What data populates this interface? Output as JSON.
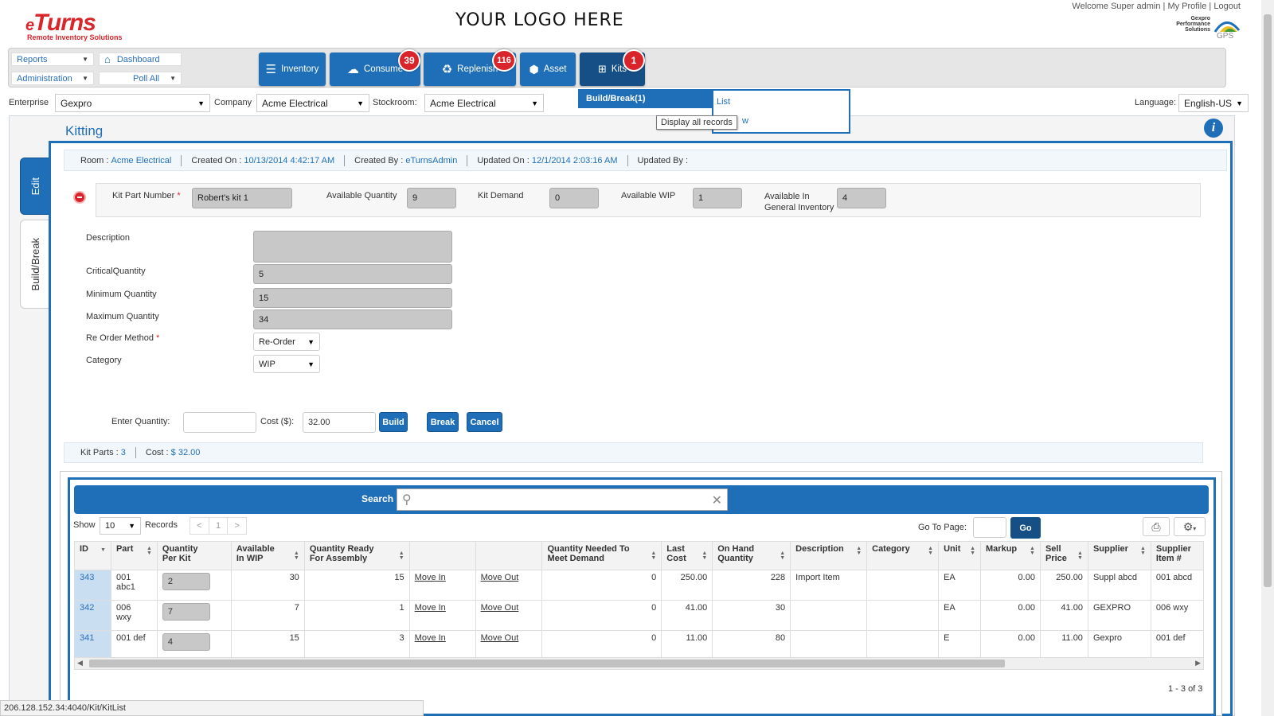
{
  "header": {
    "logo_e": "e",
    "logo_word": "Turns",
    "logo_sub": "Remote Inventory Solutions",
    "center_logo": "YOUR LOGO HERE",
    "welcome": "Welcome Super admin",
    "my_profile": "My Profile",
    "logout": "Logout",
    "gps_line1": "Gexpro",
    "gps_line2": "Performance",
    "gps_line3": "Solutions",
    "gps_abbr": "GPS"
  },
  "toolbar": {
    "reports": "Reports",
    "dashboard": "Dashboard",
    "administration": "Administration",
    "poll_all": "Poll All",
    "nav": [
      {
        "label": "Inventory",
        "icon": "list-icon"
      },
      {
        "label": "Consume",
        "icon": "cloud-upload-icon",
        "badge": "39"
      },
      {
        "label": "Replenish",
        "icon": "recycle-icon",
        "badge": "116"
      },
      {
        "label": "Asset",
        "icon": "cube-icon"
      },
      {
        "label": "Kits",
        "icon": "sitemap-icon",
        "badge": "1"
      }
    ]
  },
  "filters": {
    "enterprise_label": "Enterprise",
    "enterprise_value": "Gexpro",
    "company_label": "Company",
    "company_value": "Acme Electrical",
    "stockroom_label": "Stockroom:",
    "stockroom_value": "Acme Electrical",
    "language_label": "Language:",
    "language_value": "English-US"
  },
  "kits_menu": {
    "build_break": "Build/Break(1)",
    "list": "List",
    "new_partial": "w",
    "tooltip": "Display all records"
  },
  "page": {
    "title": "Kitting",
    "tabs": [
      "Edit",
      "Build/Break"
    ]
  },
  "info": {
    "room_label": "Room :",
    "room_value": "Acme Electrical",
    "created_on_label": "Created On :",
    "created_on_value": "10/13/2014 4:42:17 AM",
    "created_by_label": "Created By :",
    "created_by_value": "eTurnsAdmin",
    "updated_on_label": "Updated On :",
    "updated_on_value": "12/1/2014 2:03:16 AM",
    "updated_by_label": "Updated By :",
    "updated_by_value": ""
  },
  "kit": {
    "kit_part_label": "Kit Part Number",
    "kit_part_value": "Robert's kit 1",
    "avail_qty_label": "Available Quantity",
    "avail_qty_value": "9",
    "kit_demand_label": "Kit Demand",
    "kit_demand_value": "0",
    "avail_wip_label": "Available WIP",
    "avail_wip_value": "1",
    "avail_gen_label1": "Available In",
    "avail_gen_label2": "General Inventory",
    "avail_gen_value": "4"
  },
  "form": {
    "description_label": "Description",
    "description_value": "",
    "critical_label": "CriticalQuantity",
    "critical_value": "5",
    "minimum_label": "Minimum Quantity",
    "minimum_value": "15",
    "maximum_label": "Maximum Quantity",
    "maximum_value": "34",
    "reorder_label": "Re Order Method",
    "reorder_value": "Re-Order",
    "category_label": "Category",
    "category_value": "WIP",
    "enter_qty_label": "Enter Quantity:",
    "enter_qty_value": "",
    "cost_label": "Cost ($):",
    "cost_value": "32.00",
    "build": "Build",
    "break": "Break",
    "cancel": "Cancel"
  },
  "summary": {
    "kit_parts_label": "Kit Parts :",
    "kit_parts_value": "3",
    "cost_label": "Cost :",
    "cost_value": "$ 32.00"
  },
  "grid": {
    "search_label": "Search",
    "search_value": "",
    "show_label": "Show",
    "show_value": "10",
    "records_label": "Records",
    "page_prev": "<",
    "page_current": "1",
    "page_next": ">",
    "goto_label": "Go To Page:",
    "go_button": "Go",
    "footer": "1 - 3 of 3",
    "columns": [
      [
        "ID",
        ""
      ],
      [
        "Part",
        ""
      ],
      [
        "Quantity",
        "Per Kit"
      ],
      [
        "Available",
        "In WIP"
      ],
      [
        "Quantity Ready",
        "For Assembly"
      ],
      [
        "",
        ""
      ],
      [
        "",
        ""
      ],
      [
        "Quantity Needed To",
        "Meet Demand"
      ],
      [
        "Last",
        "Cost"
      ],
      [
        "On Hand",
        "Quantity"
      ],
      [
        "Description",
        ""
      ],
      [
        "Category",
        ""
      ],
      [
        "Unit",
        ""
      ],
      [
        "Markup",
        ""
      ],
      [
        "Sell",
        "Price"
      ],
      [
        "Supplier",
        ""
      ],
      [
        "Supplier",
        "Item #"
      ]
    ],
    "rows": [
      {
        "id": "343",
        "part1": "001",
        "part2": "abc1",
        "qty_per_kit": "2",
        "wip": "30",
        "ready": "15",
        "move_in": "Move In",
        "move_out": "Move Out",
        "needed": "0",
        "last_cost": "250.00",
        "on_hand": "228",
        "description": "Import Item",
        "category": "",
        "unit": "EA",
        "markup": "0.00",
        "sell": "250.00",
        "supplier": "Suppl abcd",
        "supplier_item": "001 abcd"
      },
      {
        "id": "342",
        "part1": "006",
        "part2": "wxy",
        "qty_per_kit": "7",
        "wip": "7",
        "ready": "1",
        "move_in": "Move In",
        "move_out": "Move Out",
        "needed": "0",
        "last_cost": "41.00",
        "on_hand": "30",
        "description": "",
        "category": "",
        "unit": "EA",
        "markup": "0.00",
        "sell": "41.00",
        "supplier": "GEXPRO",
        "supplier_item": "006 wxy"
      },
      {
        "id": "341",
        "part1": "001 def",
        "part2": "",
        "qty_per_kit": "4",
        "wip": "15",
        "ready": "3",
        "move_in": "Move In",
        "move_out": "Move Out",
        "needed": "0",
        "last_cost": "11.00",
        "on_hand": "80",
        "description": "",
        "category": "",
        "unit": "E",
        "markup": "0.00",
        "sell": "11.00",
        "supplier": "Gexpro",
        "supplier_item": "001 def"
      }
    ]
  },
  "status_bar": "206.128.152.34:4040/Kit/KitList",
  "colors": {
    "primary": "#1f6fb8",
    "badge": "#d9242b",
    "brand": "#d8262b"
  }
}
